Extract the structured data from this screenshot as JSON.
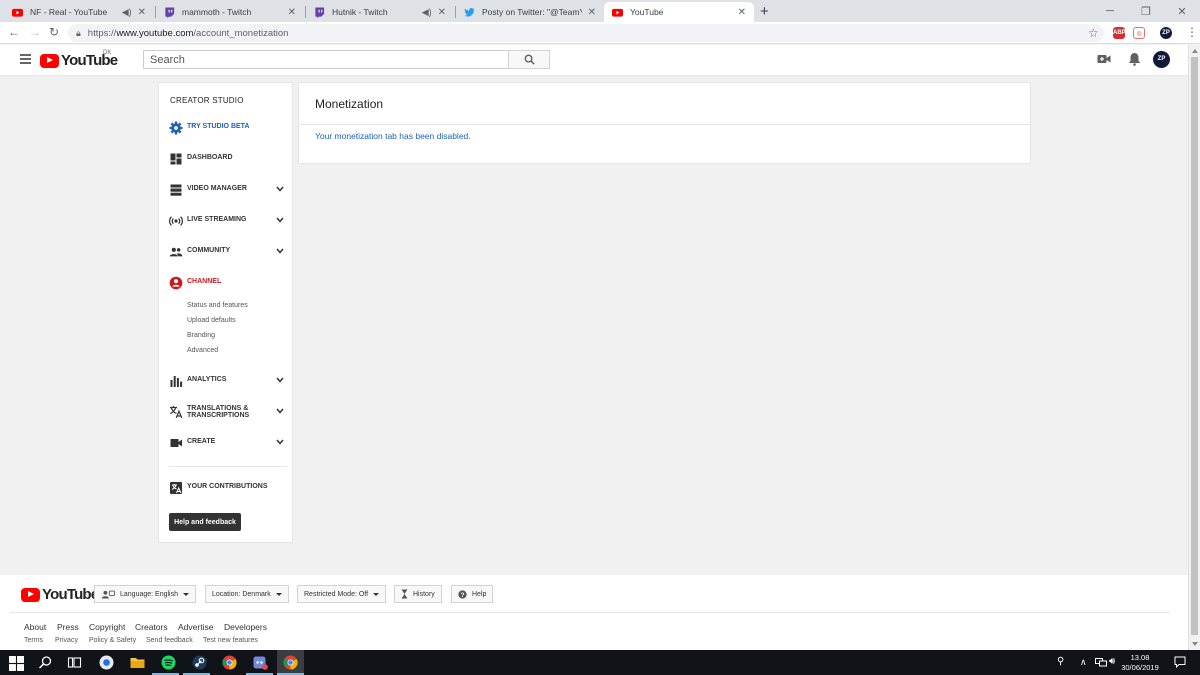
{
  "browser": {
    "tabs": [
      {
        "title": "NF - Real - YouTube",
        "favicon": "youtube-icon",
        "audio": true
      },
      {
        "title": "mammoth - Twitch",
        "favicon": "twitch-icon",
        "audio": false
      },
      {
        "title": "Hutnik - Twitch",
        "favicon": "twitch-icon",
        "audio": true
      },
      {
        "title": "Posty on Twitter: \"@TeamYouTub",
        "favicon": "twitter-icon",
        "audio": false
      },
      {
        "title": "YouTube",
        "favicon": "youtube-icon",
        "audio": false
      }
    ],
    "address": {
      "scheme": "https://",
      "host": "www.youtube.com",
      "path": "/account_monetization"
    }
  },
  "header": {
    "logo_word": "YouTube",
    "country_code": "DK",
    "search_placeholder": "Search"
  },
  "sidebar": {
    "title": "CREATOR STUDIO",
    "items": [
      {
        "label": "TRY STUDIO BETA",
        "icon": "gear-icon",
        "expandable": false
      },
      {
        "label": "DASHBOARD",
        "icon": "dashboard-icon",
        "expandable": false
      },
      {
        "label": "VIDEO MANAGER",
        "icon": "video-manager-icon",
        "expandable": true
      },
      {
        "label": "LIVE STREAMING",
        "icon": "live-streaming-icon",
        "expandable": true
      },
      {
        "label": "COMMUNITY",
        "icon": "community-icon",
        "expandable": true
      },
      {
        "label": "CHANNEL",
        "icon": "channel-icon",
        "expandable": false
      },
      {
        "label": "ANALYTICS",
        "icon": "analytics-icon",
        "expandable": true
      },
      {
        "label": "TRANSLATIONS &",
        "label2": "TRANSCRIPTIONS",
        "icon": "translate-icon",
        "expandable": true
      },
      {
        "label": "CREATE",
        "icon": "create-icon",
        "expandable": true
      },
      {
        "label": "YOUR CONTRIBUTIONS",
        "icon": "contributions-icon",
        "expandable": false
      }
    ],
    "channel_subitems": [
      "Status and features",
      "Upload defaults",
      "Branding",
      "Advanced"
    ],
    "help_button": "Help and feedback"
  },
  "main": {
    "title": "Monetization",
    "message": "Your monetization tab has been disabled."
  },
  "footer": {
    "language": "Language: English",
    "location": "Location: Denmark",
    "restricted": "Restricted Mode: Off",
    "history": "History",
    "help": "Help",
    "links": [
      "About",
      "Press",
      "Copyright",
      "Creators",
      "Advertise",
      "Developers"
    ],
    "links2": [
      "Terms",
      "Privacy",
      "Policy & Safety",
      "Send feedback",
      "Test new features"
    ]
  },
  "taskbar": {
    "time": "13.08",
    "date": "30/06/2019"
  },
  "colors": {
    "brand_red": "#ff0000",
    "link_blue": "#1c62b9",
    "active_red": "#cc181e"
  }
}
